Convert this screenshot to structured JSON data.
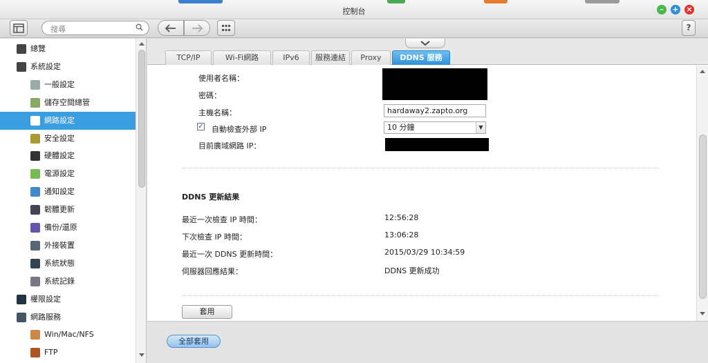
{
  "window": {
    "title": "控制台"
  },
  "toolbar": {
    "search_placeholder": "搜尋",
    "help_label": "?"
  },
  "sidebar": {
    "items": [
      {
        "label": "總覽",
        "icon": "overview-icon",
        "level": 0
      },
      {
        "label": "系統設定",
        "icon": "gear-icon",
        "level": 0
      },
      {
        "label": "一般設定",
        "icon": "general-settings-icon",
        "level": 1
      },
      {
        "label": "儲存空間總管",
        "icon": "storage-icon",
        "level": 1
      },
      {
        "label": "網路設定",
        "icon": "network-icon",
        "level": 1,
        "active": true
      },
      {
        "label": "安全設定",
        "icon": "lock-icon",
        "level": 1
      },
      {
        "label": "硬體設定",
        "icon": "hardware-icon",
        "level": 1
      },
      {
        "label": "電源設定",
        "icon": "power-bulb-icon",
        "level": 1
      },
      {
        "label": "通知設定",
        "icon": "notification-icon",
        "level": 1
      },
      {
        "label": "韌體更新",
        "icon": "firmware-icon",
        "level": 1
      },
      {
        "label": "備份/還原",
        "icon": "backup-icon",
        "level": 1
      },
      {
        "label": "外接裝置",
        "icon": "external-device-icon",
        "level": 1
      },
      {
        "label": "系統狀態",
        "icon": "monitor-icon",
        "level": 1
      },
      {
        "label": "系統記錄",
        "icon": "log-icon",
        "level": 1
      },
      {
        "label": "權限設定",
        "icon": "user-permission-icon",
        "level": 0
      },
      {
        "label": "網路服務",
        "icon": "globe-icon",
        "level": 0
      },
      {
        "label": "Win/Mac/NFS",
        "icon": "win-mac-nfs-icon",
        "level": 1
      },
      {
        "label": "FTP",
        "icon": "ftp-icon",
        "level": 1
      }
    ]
  },
  "tabs": [
    {
      "label": "TCP/IP"
    },
    {
      "label": "Wi-Fi網路"
    },
    {
      "label": "IPv6"
    },
    {
      "label": "服務連結"
    },
    {
      "label": "Proxy"
    },
    {
      "label": "DDNS 服務",
      "active": true
    }
  ],
  "form": {
    "username_label": "使用者名稱：",
    "password_label": "密碼：",
    "hostname_label": "主機名稱：",
    "hostname_value": "hardaway2.zapto.org",
    "auto_check_label": "自動檢查外部 IP",
    "auto_check_checked": true,
    "interval_value": "10 分鐘",
    "wan_ip_label": "目前廣域網路 IP："
  },
  "result": {
    "title": "DDNS 更新結果",
    "rows": [
      {
        "label": "最近一次檢查 IP 時間：",
        "value": "12:56:28"
      },
      {
        "label": "下次檢查 IP 時間：",
        "value": "13:06:28"
      },
      {
        "label": "最近一次 DDNS 更新時間：",
        "value": "2015/03/29 10:34:59"
      },
      {
        "label": "伺服器回應結果：",
        "value": "DDNS 更新成功"
      }
    ]
  },
  "buttons": {
    "apply": "套用",
    "apply_all": "全部套用"
  },
  "colors": {
    "accent": "#3a9ee0",
    "tab_active": "#2f8fd8",
    "win_min": "#4cb84a",
    "win_max": "#2f8fd8",
    "win_close": "#e0322f"
  }
}
